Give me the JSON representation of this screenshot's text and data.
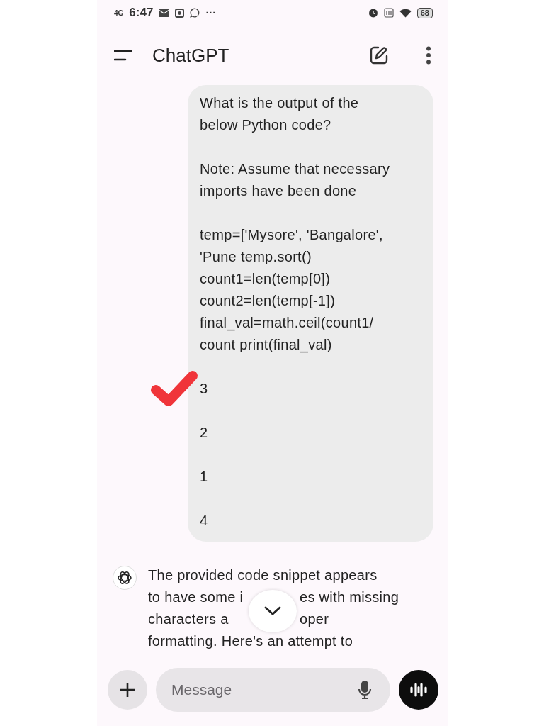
{
  "status_bar": {
    "network": "4G",
    "time": "6:47",
    "more": "···",
    "battery": "68"
  },
  "app_bar": {
    "title": "ChatGPT"
  },
  "user_message": {
    "blocks": [
      [
        "What is the output of the",
        "below Python code?"
      ],
      [
        "Note: Assume that necessary",
        "imports have been done"
      ],
      [
        "temp=['Mysore', 'Bangalore',",
        "'Pune temp.sort()",
        "count1=len(temp[0])",
        "count2=len(temp[-1])",
        "final_val=math.ceil(count1/",
        "count print(final_val)"
      ],
      [
        "3"
      ],
      [
        "2"
      ],
      [
        "1"
      ],
      [
        "4"
      ]
    ]
  },
  "assistant_message": {
    "lines": [
      [
        "The provided code snippet appears"
      ],
      [
        "to have some i",
        "es with missing"
      ],
      [
        "characters a",
        "oper"
      ],
      [
        "formatting. Here's an attempt to"
      ]
    ]
  },
  "composer": {
    "placeholder": "Message"
  }
}
